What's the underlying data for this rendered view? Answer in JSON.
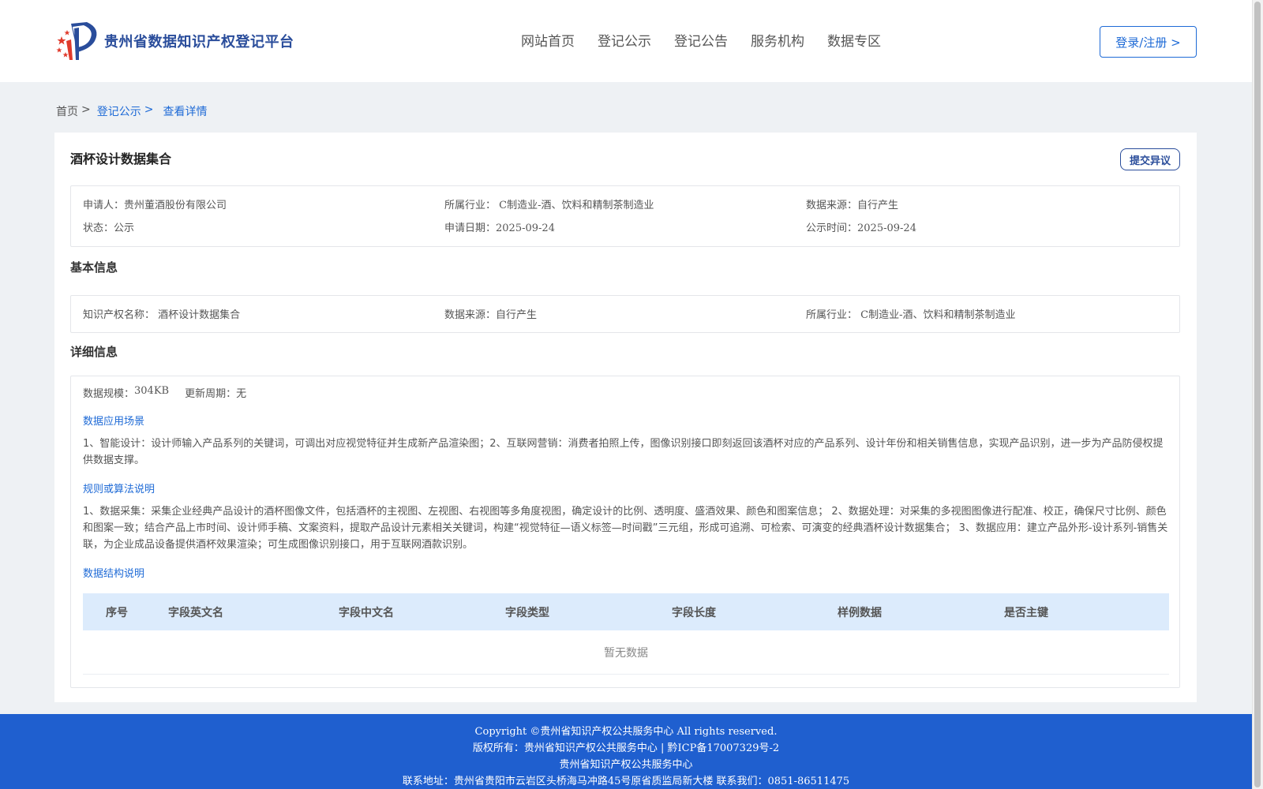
{
  "header": {
    "logo_text": "贵州省数据知识产权登记平台",
    "nav": [
      "网站首页",
      "登记公示",
      "登记公告",
      "服务机构",
      "数据专区"
    ],
    "login_label": "登录/注册 >"
  },
  "breadcrumb": {
    "home": "首页",
    "public": "登记公示",
    "detail": "查看详情",
    "sep": ">"
  },
  "record": {
    "title": "酒杯设计数据集合",
    "objection_label": "提交异议",
    "summary": {
      "applicant_label": "申请人：",
      "applicant": "贵州董酒股份有限公司",
      "industry_label": "所属行业：",
      "industry": "C制造业-酒、饮料和精制茶制造业",
      "source_label": "数据来源：",
      "source": "自行产生",
      "status_label": "状态：",
      "status": "公示",
      "apply_date_label": "申请日期：",
      "apply_date": "2025-09-24",
      "publish_date_label": "公示时间：",
      "publish_date": "2025-09-24"
    },
    "basic": {
      "section_title": "基本信息",
      "name_label": "知识产权名称：",
      "name": "酒杯设计数据集合",
      "source_label": "数据来源：",
      "source": "自行产生",
      "industry_label": "所属行业：",
      "industry": "C制造业-酒、饮料和精制茶制造业"
    },
    "detail": {
      "section_title": "详细信息",
      "scale_label": "数据规模：",
      "scale": "304KB",
      "cycle_label": "更新周期：",
      "cycle": "无",
      "scenario_title": "数据应用场景",
      "scenario_text": "1、智能设计：设计师输入产品系列的关键词，可调出对应视觉特征并生成新产品渲染图；2、互联网营销：消费者拍照上传，图像识别接口即刻返回该酒杯对应的产品系列、设计年份和相关销售信息，实现产品识别，进一步为产品防侵权提供数据支撑。",
      "rules_title": "规则或算法说明",
      "rules_text": "1、数据采集：采集企业经典产品设计的酒杯图像文件，包括酒杯的主视图、左视图、右视图等多角度视图，确定设计的比例、透明度、盛酒效果、颜色和图案信息； 2、数据处理：对采集的多视图图像进行配准、校正，确保尺寸比例、颜色和图案一致；结合产品上市时间、设计师手稿、文案资料，提取产品设计元素相关关键词，构建“视觉特征—语义标签—时间戳”三元组，形成可追溯、可检索、可演变的经典酒杯设计数据集合； 3、数据应用：建立产品外形-设计系列-销售关联，为企业成品设备提供酒杯效果渲染；可生成图像识别接口，用于互联网酒款识别。",
      "structure_title": "数据结构说明",
      "table_headers": [
        "序号",
        "字段英文名",
        "字段中文名",
        "字段类型",
        "字段长度",
        "样例数据",
        "是否主键"
      ],
      "empty_text": "暂无数据"
    }
  },
  "footer": {
    "lines": [
      "Copyright ©贵州省知识产权公共服务中心 All rights reserved.",
      "版权所有：贵州省知识产权公共服务中心 | 黔ICP备17007329号-2",
      "贵州省知识产权公共服务中心",
      "联系地址：贵州省贵阳市云岩区头桥海马冲路45号原省质监局新大楼 联系我们：0851-86511475"
    ]
  }
}
